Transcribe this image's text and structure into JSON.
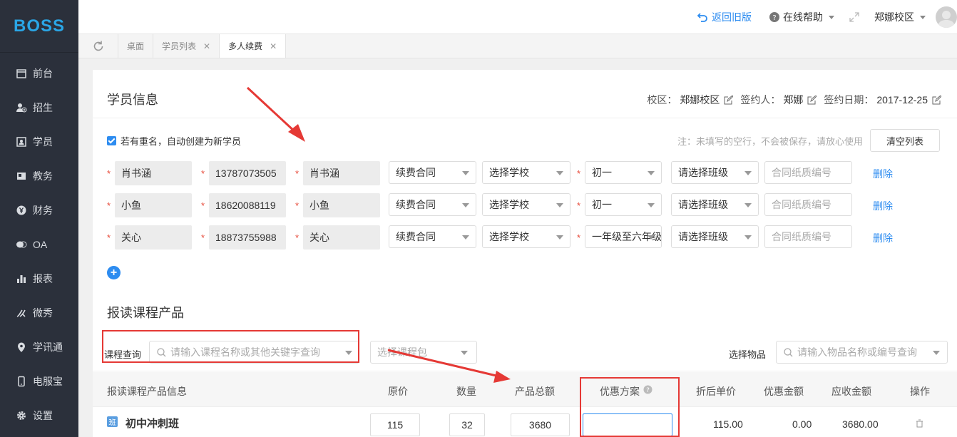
{
  "app": {
    "logo": "BOSS"
  },
  "sidebar": {
    "items": [
      {
        "label": "前台",
        "icon": "calendar-icon"
      },
      {
        "label": "招生",
        "icon": "user-add-icon"
      },
      {
        "label": "学员",
        "icon": "id-card-icon"
      },
      {
        "label": "教务",
        "icon": "book-icon"
      },
      {
        "label": "财务",
        "icon": "yen-icon"
      },
      {
        "label": "OA",
        "icon": "chat-icon"
      },
      {
        "label": "报表",
        "icon": "bar-chart-icon"
      },
      {
        "label": "微秀",
        "icon": "brush-icon"
      },
      {
        "label": "学讯通",
        "icon": "location-pin-icon"
      },
      {
        "label": "电服宝",
        "icon": "phone-icon"
      },
      {
        "label": "设置",
        "icon": "gear-icon"
      }
    ]
  },
  "topbar": {
    "back_label": "返回旧版",
    "help_label": "在线帮助",
    "campus_label": "郑娜校区"
  },
  "tabs": [
    {
      "label": "桌面",
      "closable": false,
      "active": false
    },
    {
      "label": "学员列表",
      "closable": true,
      "active": false
    },
    {
      "label": "多人续费",
      "closable": true,
      "active": true
    }
  ],
  "colors": {
    "accent": "#2d8cf0",
    "sidebar_bg": "#2b303b",
    "annotation": "#e53935"
  },
  "student_section": {
    "title": "学员信息",
    "campus_label": "校区：",
    "campus_value": "郑娜校区",
    "signer_label": "签约人：",
    "signer_value": "郑娜",
    "date_label": "签约日期：",
    "date_value": "2017-12-25",
    "auto_create_label": "若有重名，自动创建为新学员",
    "auto_create_checked": true,
    "note": "注：未填写的空行，不会被保存，请放心使用",
    "clear_button": "清空列表",
    "rows": [
      {
        "name": "肖书涵",
        "phone": "13787073505",
        "contact": "肖书涵",
        "contract": "续费合同",
        "school": "选择学校",
        "grade": "初一",
        "class": "请选择班级",
        "paper_no_placeholder": "合同纸质编号",
        "delete": "删除"
      },
      {
        "name": "小鱼",
        "phone": "18620088119",
        "contact": "小鱼",
        "contract": "续费合同",
        "school": "选择学校",
        "grade": "初一",
        "class": "请选择班级",
        "paper_no_placeholder": "合同纸质编号",
        "delete": "删除"
      },
      {
        "name": "关心",
        "phone": "18873755988",
        "contact": "关心",
        "contract": "续费合同",
        "school": "选择学校",
        "grade": "一年级至六年级",
        "class": "请选择班级",
        "paper_no_placeholder": "合同纸质编号",
        "delete": "删除"
      }
    ]
  },
  "course_section": {
    "title": "报读课程产品",
    "query_label": "课程查询",
    "query_placeholder": "请输入课程名称或其他关键字查询",
    "package_placeholder": "选择课程包",
    "goods_label": "选择物品",
    "goods_placeholder": "请输入物品名称或编号查询",
    "columns": [
      "报读课程产品信息",
      "原价",
      "数量",
      "产品总额",
      "优惠方案",
      "折后单价",
      "优惠金额",
      "应收金额",
      "操作"
    ],
    "rows": [
      {
        "badge": "班",
        "name": "初中冲刺班",
        "price": "115",
        "qty": "32",
        "total": "3680",
        "discount": "",
        "unit_after": "115.00",
        "discount_amount": "0.00",
        "receivable": "3680.00"
      }
    ]
  }
}
